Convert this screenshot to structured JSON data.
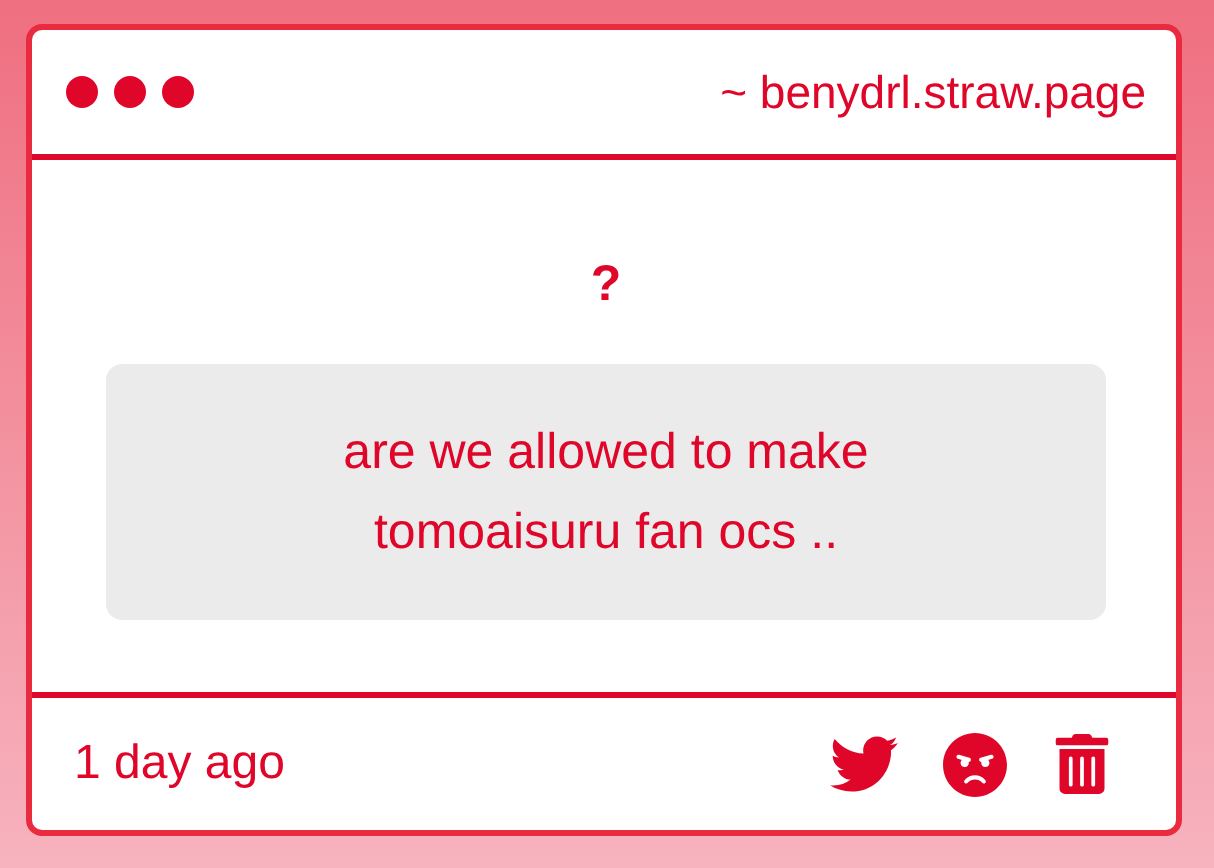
{
  "window": {
    "address": "~ benydrl.straw.page"
  },
  "prompt": "?",
  "message": "are we allowed to make tomoaisuru fan ocs ..",
  "footer": {
    "time": "1 day ago"
  }
}
